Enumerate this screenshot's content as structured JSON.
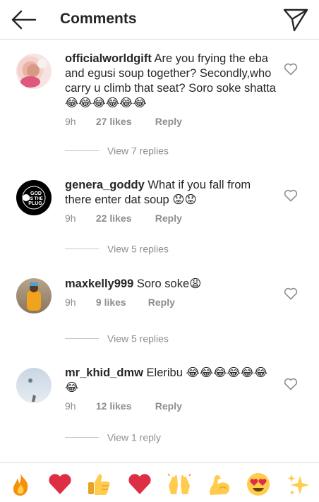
{
  "header": {
    "title": "Comments",
    "back_icon": "arrow-left-icon",
    "share_icon": "paper-plane-icon"
  },
  "comments": [
    {
      "username": "officialworldgift",
      "text": "Are you frying the eba and egusi soup together? Secondly,who carry u climb that seat? Soro soke shatta",
      "emojis": "😂😂😂😂😂😂",
      "time": "9h",
      "likes": "27 likes",
      "reply_label": "Reply",
      "view_replies": "View 7 replies"
    },
    {
      "username": "genera_goddy",
      "text": "What if you fall from there enter dat soup",
      "emojis": "😟😟",
      "time": "9h",
      "likes": "22 likes",
      "reply_label": "Reply",
      "view_replies": "View 5 replies",
      "avatar_text": "GOD IS THE PLUG."
    },
    {
      "username": "maxkelly999",
      "text": "Soro soke",
      "emojis": "😩",
      "time": "9h",
      "likes": "9 likes",
      "reply_label": "Reply",
      "view_replies": "View 5 replies"
    },
    {
      "username": "mr_khid_dmw",
      "text": "Eleribu",
      "emojis": "😂😂😂😂😂😂😂",
      "time": "9h",
      "likes": "12 likes",
      "reply_label": "Reply",
      "view_replies": "View 1 reply"
    }
  ],
  "emoji_bar": [
    "🔥",
    "❤️",
    "👍",
    "❤️",
    "🙌",
    "💪",
    "😍",
    "✨"
  ],
  "colors": {
    "text": "#262626",
    "muted": "#8e8e8e",
    "divider": "#dbdbdb"
  }
}
